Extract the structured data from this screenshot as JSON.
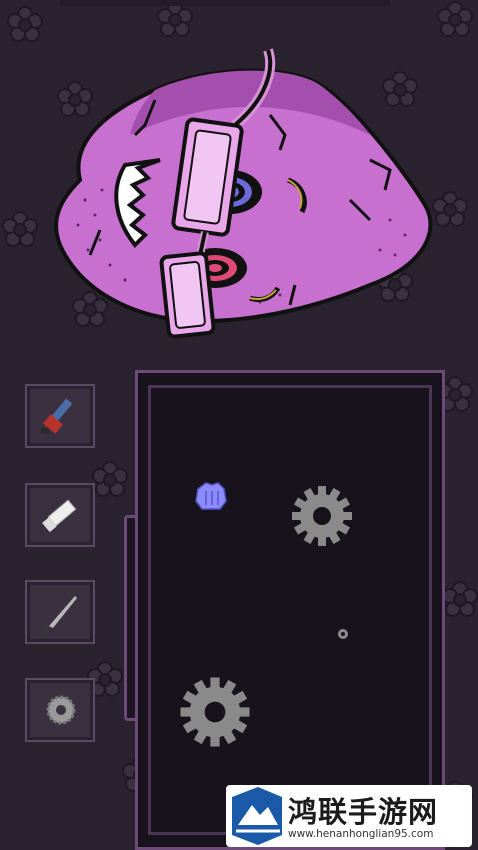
{
  "game": {
    "tools": [
      {
        "id": "chainsaw",
        "icon": "chainsaw-icon"
      },
      {
        "id": "eraser",
        "icon": "eraser-icon"
      },
      {
        "id": "knife",
        "icon": "knife-icon"
      },
      {
        "id": "saw-blade",
        "icon": "saw-blade-icon"
      }
    ],
    "board_items": [
      {
        "type": "glove",
        "icon": "glove-icon"
      },
      {
        "type": "gear",
        "icon": "gear-icon"
      },
      {
        "type": "gear",
        "icon": "gear-icon"
      },
      {
        "type": "bolt",
        "icon": "bolt-icon"
      }
    ]
  },
  "watermark": {
    "title": "鸿联手游网",
    "url": "www.henanhonglian95.com"
  },
  "colors": {
    "background": "#2b2230",
    "monster_skin": "#c770cf",
    "board_border": "#6e4a78",
    "board_fill": "#17121b",
    "gear": "#8a8a8a"
  }
}
